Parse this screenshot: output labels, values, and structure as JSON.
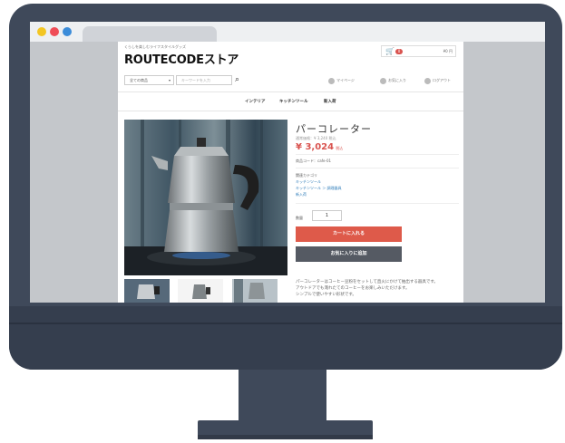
{
  "store": {
    "tagline": "くらしを楽しむライフスタイルグッズ",
    "logo": "ROUTECODEストア",
    "cart_count": "0",
    "cart_total": "¥0 円"
  },
  "search": {
    "category_value": "全ての商品",
    "keyword_placeholder": "キーワードを入力"
  },
  "header_links": [
    "マイページ",
    "お気に入り",
    "ログアウト"
  ],
  "nav": [
    "インテリア",
    "キッチンツール",
    "新入荷"
  ],
  "product": {
    "title": "パーコレーター",
    "normal_price": "通常価格：¥ 3,240 税込",
    "price": "¥ 3,024",
    "price_tax": "税込",
    "code": "商品コード：cafe-01",
    "related_label": "関連カテゴリ",
    "related": [
      "キッチンツール",
      "キッチンツール ＞ 調理器具",
      "新入荷"
    ],
    "qty_label": "数量",
    "qty_value": "1",
    "add_to_cart": "カートに入れる",
    "add_favorite": "お気に入りに追加",
    "description": [
      "パーコレーターはコーヒー豆粉をセットして直火にかけて抽出する器具です。",
      "アウトドアでも淹れたてのコーヒーをお楽しみいただけます。",
      "シンプルで使いやすい形状です。"
    ]
  },
  "icons": {
    "cart": "cart-icon",
    "search": "search-icon",
    "mypage": "user-icon",
    "favorite": "heart-icon",
    "logout": "logout-icon"
  },
  "colors": {
    "monitor": "#3f495a",
    "accent_red": "#de5a4a",
    "button_dark": "#555a63",
    "price_red": "#d9534f",
    "link_blue": "#2a7ab8"
  }
}
